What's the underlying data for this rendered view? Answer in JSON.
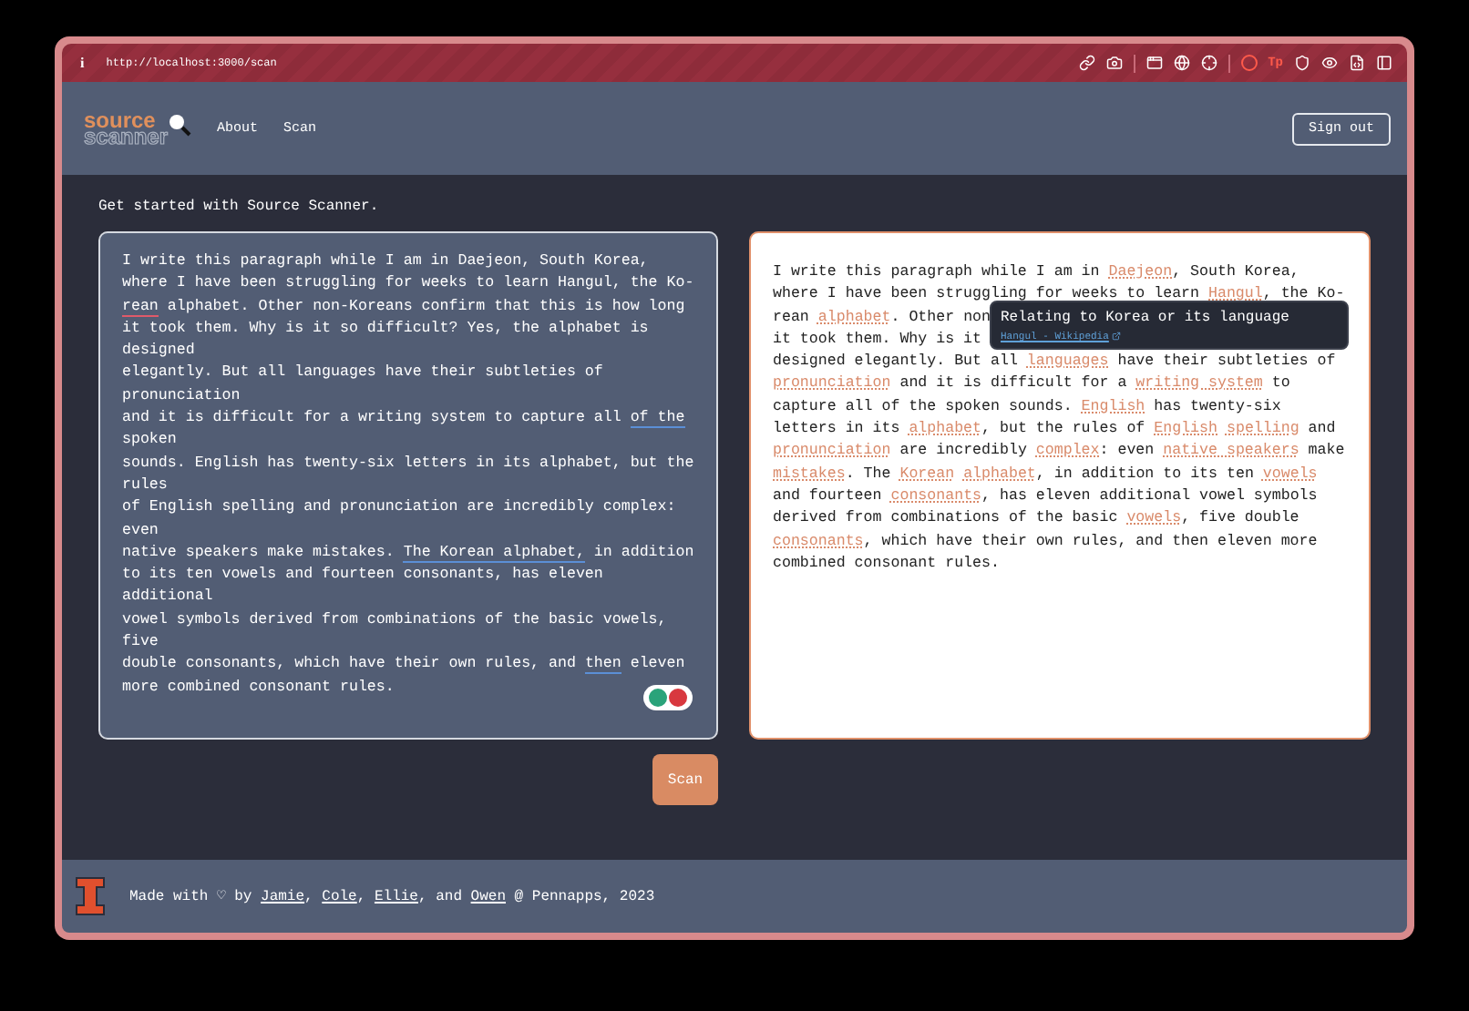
{
  "browser": {
    "info": "i",
    "url": "http://localhost:3000/scan",
    "extension_text": "Tp"
  },
  "nav": {
    "logo_top": "source",
    "logo_bottom": "scanner",
    "links": [
      "About",
      "Scan"
    ],
    "sign_out": "Sign out"
  },
  "intro": "Get started with Source Scanner.",
  "editor": {
    "lines": [
      [
        {
          "text": "I write this paragraph while I am in Daejeon, South Korea,"
        }
      ],
      [
        {
          "text": "where I have been struggling for weeks to learn Hangul, the Ko-"
        }
      ],
      [
        {
          "text": "rean",
          "kind": "spelling"
        },
        {
          "text": " alphabet. Other non-Koreans confirm that this is how long"
        }
      ],
      [
        {
          "text": "it took them. Why is it so difficult? Yes, the alphabet is"
        }
      ],
      [
        {
          "text": "designed"
        }
      ],
      [
        {
          "text": "elegantly. But all languages have their subtleties of"
        }
      ],
      [
        {
          "text": "pronunciation"
        }
      ],
      [
        {
          "text": "and it is difficult for a writing system to capture all "
        },
        {
          "text": "of the",
          "kind": "grammar"
        }
      ],
      [
        {
          "text": "spoken"
        }
      ],
      [
        {
          "text": "sounds. English has twenty-six letters in its alphabet, but the"
        }
      ],
      [
        {
          "text": "rules"
        }
      ],
      [
        {
          "text": "of English spelling and pronunciation are incredibly complex:"
        }
      ],
      [
        {
          "text": "even"
        }
      ],
      [
        {
          "text": "native speakers make mistakes. "
        },
        {
          "text": "The Korean alphabet,",
          "kind": "grammar"
        },
        {
          "text": " in addition"
        }
      ],
      [
        {
          "text": "to its ten vowels and fourteen consonants, has eleven"
        }
      ],
      [
        {
          "text": "additional"
        }
      ],
      [
        {
          "text": "vowel symbols derived from combinations of the basic vowels,"
        }
      ],
      [
        {
          "text": "five"
        }
      ],
      [
        {
          "text": "double consonants, which have their own rules, and "
        },
        {
          "text": "then",
          "kind": "grammar"
        },
        {
          "text": " eleven"
        }
      ],
      [
        {
          "text": "more combined consonant rules."
        }
      ]
    ]
  },
  "scan_button": "Scan",
  "result": {
    "lines": [
      [
        {
          "text": "I write this paragraph while I am in "
        },
        {
          "text": "Daejeon",
          "kind": "link"
        },
        {
          "text": ", South Korea,"
        }
      ],
      [
        {
          "text": "where I have been struggling for weeks to learn "
        },
        {
          "text": "Hangul",
          "kind": "link"
        },
        {
          "text": ", the Ko-"
        }
      ],
      [
        {
          "text": "rean "
        },
        {
          "text": "alphabet",
          "kind": "link"
        },
        {
          "text": ". Other non"
        }
      ],
      [
        {
          "text": "it took them. Why is it"
        }
      ],
      [
        {
          "text": "designed elegantly. But all "
        },
        {
          "text": "languages",
          "kind": "link"
        },
        {
          "text": " have their subtleties of"
        }
      ],
      [
        {
          "text": "pronunciation",
          "kind": "link"
        },
        {
          "text": " and it is difficult for a "
        },
        {
          "text": "writing system",
          "kind": "link"
        },
        {
          "text": " to"
        }
      ],
      [
        {
          "text": "capture all of the spoken sounds. "
        },
        {
          "text": "English",
          "kind": "link"
        },
        {
          "text": " has twenty-six"
        }
      ],
      [
        {
          "text": "letters in its "
        },
        {
          "text": "alphabet",
          "kind": "link"
        },
        {
          "text": ", but the rules of "
        },
        {
          "text": "English",
          "kind": "link"
        },
        {
          "text": "spelling",
          "kind": "link"
        },
        {
          "text": " and"
        }
      ],
      [
        {
          "text": "pronunciation",
          "kind": "link"
        },
        {
          "text": " are incredibly "
        },
        {
          "text": "complex",
          "kind": "link"
        },
        {
          "text": ": even "
        },
        {
          "text": "native speakers",
          "kind": "link"
        },
        {
          "text": " make"
        }
      ],
      [
        {
          "text": "mistakes",
          "kind": "link"
        },
        {
          "text": ". The "
        },
        {
          "text": "Korean",
          "kind": "link"
        },
        {
          "text": "alphabet",
          "kind": "link"
        },
        {
          "text": ", in addition to its ten "
        },
        {
          "text": "vowels",
          "kind": "link"
        }
      ],
      [
        {
          "text": "and fourteen "
        },
        {
          "text": "consonants",
          "kind": "link"
        },
        {
          "text": ", has eleven additional vowel symbols"
        }
      ],
      [
        {
          "text": "derived from combinations of the basic "
        },
        {
          "text": "vowels",
          "kind": "link"
        },
        {
          "text": ", five double"
        }
      ],
      [
        {
          "text": "consonants",
          "kind": "link"
        },
        {
          "text": ", which have their own rules, and then eleven more"
        }
      ],
      [
        {
          "text": "combined consonant rules."
        }
      ]
    ],
    "tooltip": {
      "title": "Relating to Korea or its language",
      "link": "Hangul - Wikipedia"
    }
  },
  "footer": {
    "parts": [
      {
        "text": "Made with ♡ by "
      },
      {
        "text": "Jamie",
        "kind": "link"
      },
      {
        "text": ", "
      },
      {
        "text": "Cole",
        "kind": "link"
      },
      {
        "text": ", "
      },
      {
        "text": "Ellie",
        "kind": "link"
      },
      {
        "text": ", and "
      },
      {
        "text": "Owen",
        "kind": "link"
      },
      {
        "text": " @ Pennapps, 2023"
      }
    ]
  }
}
